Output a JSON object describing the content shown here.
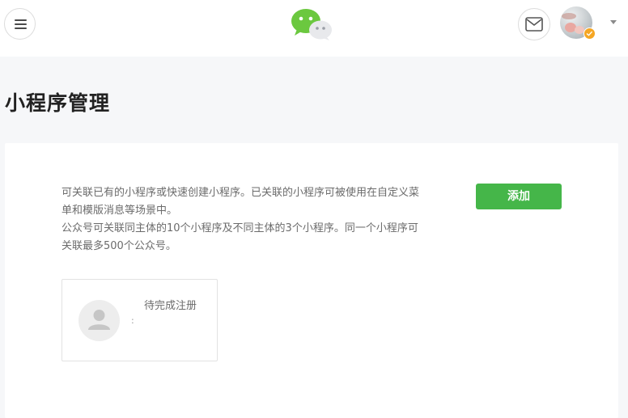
{
  "header": {
    "menu_icon": "hamburger-menu-icon",
    "logo_icon": "wechat-logo-icon",
    "mail_icon": "envelope-icon",
    "verified_icon": "verified-check-icon",
    "caret_icon": "caret-down-icon"
  },
  "page": {
    "title": "小程序管理"
  },
  "card": {
    "description_lines": [
      "可关联已有的小程序或快速创建小程序。已关联的小程序可被使用在自定义菜",
      "单和模版消息等场景中。",
      "公众号可关联同主体的10个小程序及不同主体的3个小程序。同一个小程序可",
      "关联最多500个公众号。"
    ],
    "add_button_label": "添加",
    "app_item": {
      "status": "待完成注册",
      "separator": ":"
    }
  },
  "colors": {
    "accent_green": "#45b649",
    "background": "#f6f7f9",
    "badge_orange": "#f5a623"
  }
}
